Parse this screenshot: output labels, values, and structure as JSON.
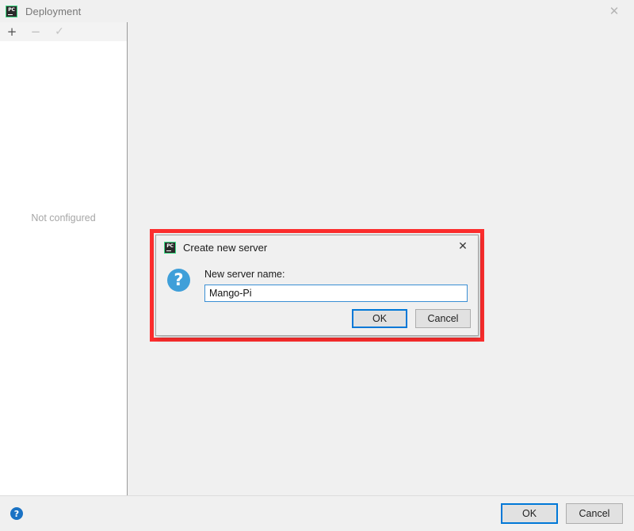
{
  "window": {
    "title": "Deployment",
    "app_icon": "pycharm-icon",
    "close_icon": "close-icon",
    "close_glyph": "✕"
  },
  "toolbar": {
    "add_label": "+",
    "add_icon": "plus-icon",
    "remove_label": "−",
    "remove_icon": "minus-icon",
    "apply_label": "✓",
    "apply_icon": "check-icon"
  },
  "left_pane": {
    "empty_text": "Not configured"
  },
  "bottom_bar": {
    "help_glyph": "?",
    "help_icon": "help-icon",
    "ok_label": "OK",
    "cancel_label": "Cancel"
  },
  "dialog": {
    "title": "Create new server",
    "app_icon": "pycharm-icon",
    "close_glyph": "✕",
    "close_icon": "close-icon",
    "question_glyph": "?",
    "question_icon": "question-icon",
    "field_label": "New server name:",
    "field_value": "Mango-Pi",
    "field_placeholder": "",
    "ok_label": "OK",
    "cancel_label": "Cancel",
    "highlight_color": "#fc2d2d",
    "focus_color": "#0078d7"
  }
}
